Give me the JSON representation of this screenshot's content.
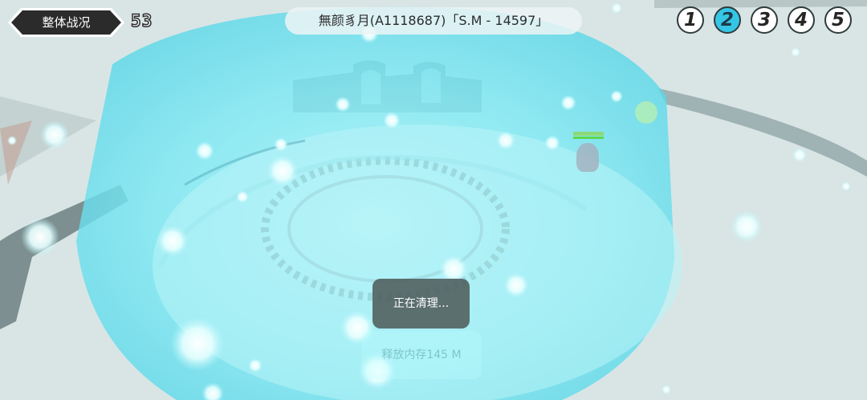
{
  "hud": {
    "overview_label": "整体战况",
    "round_count": "53",
    "player_tag": "無颜豸月(A1118687)「S.M - 14597」"
  },
  "camera_buttons": [
    {
      "label": "1",
      "active": false
    },
    {
      "label": "2",
      "active": true
    },
    {
      "label": "3",
      "active": false
    },
    {
      "label": "4",
      "active": false
    },
    {
      "label": "5",
      "active": false
    }
  ],
  "toast": {
    "cleaning": "正在清理...",
    "released": "释放内存145 M"
  },
  "colors": {
    "active_camera": "#35c6e6",
    "shield": "#6fe6f3",
    "arena_floor": "#dbe6e6"
  }
}
